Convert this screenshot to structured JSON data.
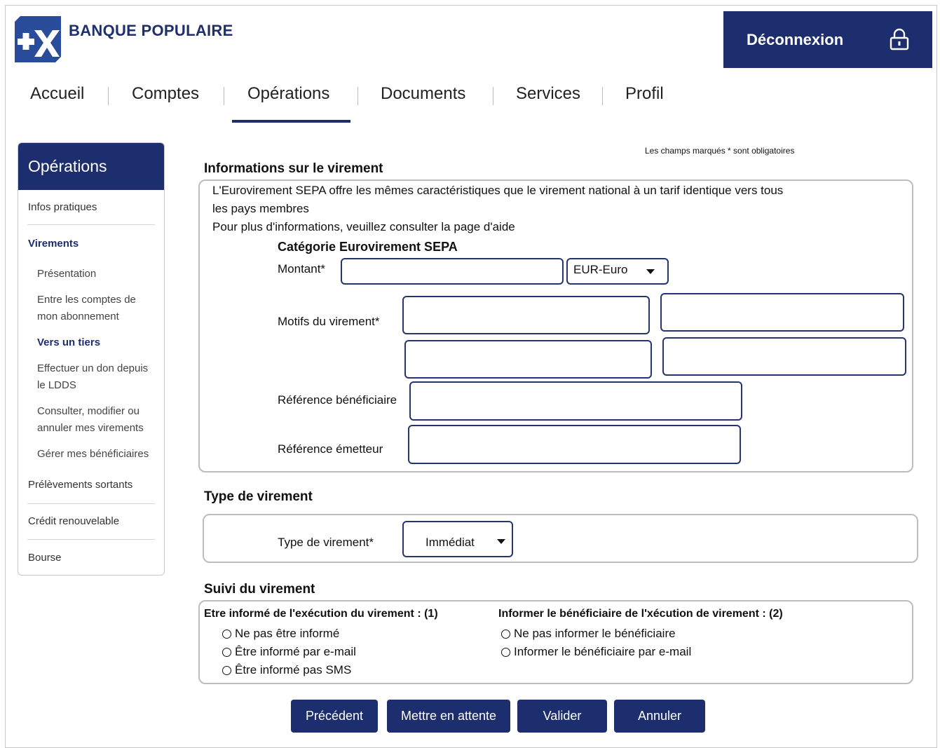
{
  "header": {
    "brand": "BANQUE POPULAIRE",
    "logout_label": "Déconnexion",
    "colors": {
      "brand_navy": "#1c2e6e",
      "logo_blue": "#2a4d9b"
    }
  },
  "nav": {
    "items": [
      "Accueil",
      "Comptes",
      "Opérations",
      "Documents",
      "Services",
      "Profil"
    ],
    "active": "Opérations"
  },
  "sidebar": {
    "title": "Opérations",
    "items": [
      "Infos pratiques",
      "Virements",
      "Présentation",
      "Entre les comptes de",
      "mon abonnement",
      "Vers un tiers",
      "Effectuer un don depuis",
      "le LDDS",
      "Consulter, modifier ou",
      "annuler mes virements",
      "Gérer mes bénéficiaires",
      "Prélèvements sortants",
      "Crédit renouvelable",
      "Bourse"
    ]
  },
  "form": {
    "required_note": "Les champs marqués * sont obligatoires",
    "info": {
      "title": "Informations sur le virement",
      "desc_line1": "L'Eurovirement SEPA offre les mêmes caractéristiques que le virement national à un tarif identique vers tous",
      "desc_line2": "les pays membres",
      "desc_line3": "Pour plus d'informations, veuillez consulter la page d'aide",
      "category": "Catégorie Eurovirement SEPA",
      "amount_label": "Montant*",
      "amount_value": "",
      "currency": "EUR-Euro",
      "reason_label": "Motifs du virement*",
      "reason_values": [
        "",
        "",
        "",
        ""
      ],
      "ref_beneficiary_label": "Référence bénéficiaire",
      "ref_beneficiary_value": "",
      "ref_sender_label": "Référence émetteur",
      "ref_sender_value": ""
    },
    "type": {
      "title": "Type de virement",
      "label": "Type de virement*",
      "selected": "Immédiat"
    },
    "tracking": {
      "title": "Suivi du virement",
      "left_heading": "Etre informé de l'exécution du virement : (1)",
      "left_options": [
        "Ne pas être informé",
        "Être informé par e-mail",
        "Être informé pas SMS"
      ],
      "right_heading": "Informer le bénéficiaire de l'xécution de virement : (2)",
      "right_options": [
        "Ne pas informer le bénéficiaire",
        "Informer le bénéficiaire par e-mail"
      ]
    }
  },
  "actions": {
    "previous": "Précédent",
    "hold": "Mettre en attente",
    "validate": "Valider",
    "cancel": "Annuler"
  }
}
